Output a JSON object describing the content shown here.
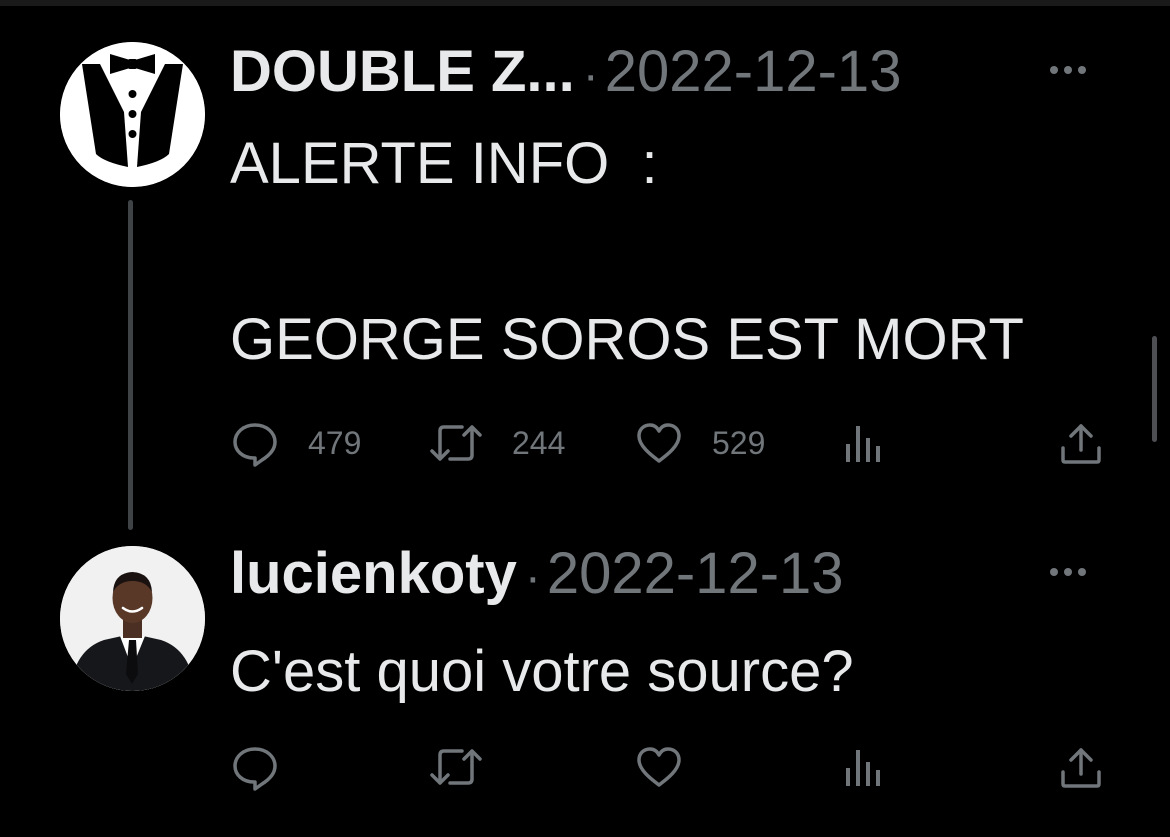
{
  "thread": [
    {
      "author": "DOUBLE Z...",
      "separator": "·",
      "date": "2022-12-13",
      "text": "ALERTE INFO  :\n\nGEORGE SOROS EST MORT",
      "stats": {
        "replies": "479",
        "retweets": "244",
        "likes": "529"
      },
      "avatar_icon": "tuxedo-logo-icon"
    },
    {
      "author": "lucienkoty",
      "separator": "·",
      "date": "2022-12-13",
      "text": "C'est quoi votre source?",
      "stats": {
        "replies": "",
        "retweets": "",
        "likes": ""
      },
      "avatar_icon": "profile-photo"
    }
  ],
  "icons": {
    "reply": "reply-icon",
    "retweet": "retweet-icon",
    "like": "heart-icon",
    "views": "views-icon",
    "share": "share-icon",
    "more": "more-icon"
  },
  "colors": {
    "background": "#000000",
    "primary_text": "#e7e9ea",
    "secondary_text": "#71767b",
    "thread_line": "#3f4346"
  }
}
